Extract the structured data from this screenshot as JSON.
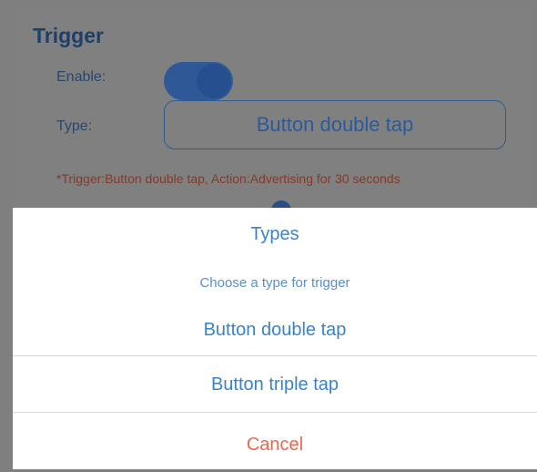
{
  "trigger": {
    "title": "Trigger",
    "enable_label": "Enable:",
    "enable_state": "on",
    "type_label": "Type:",
    "type_value": "Button double tap",
    "note": "*Trigger:Button double tap, Action:Advertising for 30 seconds"
  },
  "action_sheet": {
    "title": "Types",
    "subtitle": "Choose a type for trigger",
    "options": [
      {
        "label": "Button double tap"
      },
      {
        "label": "Button triple tap"
      }
    ],
    "cancel_label": "Cancel"
  },
  "colors": {
    "accent_blue": "#3b83c8",
    "cancel_red": "#e6694e",
    "dim_overlay": "#808080"
  }
}
